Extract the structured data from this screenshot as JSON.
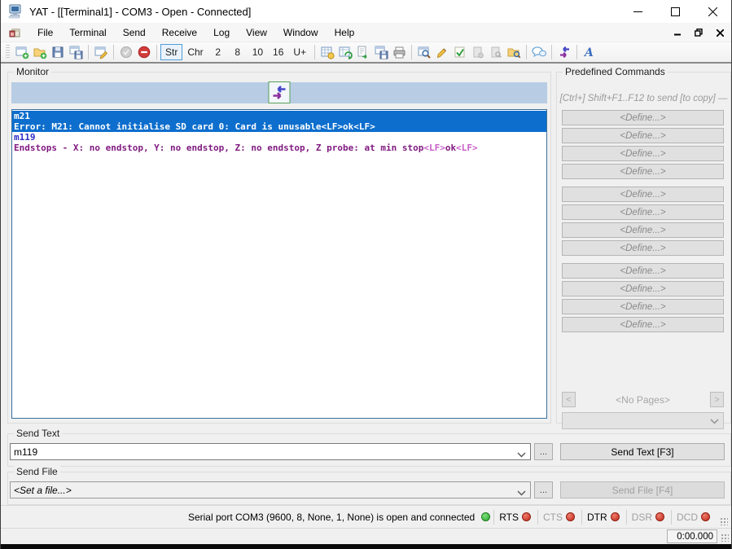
{
  "window": {
    "title": "YAT - [[Terminal1] - COM3 - Open - Connected]"
  },
  "menu": {
    "items": [
      "File",
      "Terminal",
      "Send",
      "Receive",
      "Log",
      "View",
      "Window",
      "Help"
    ]
  },
  "toolbar": {
    "radix": {
      "items": [
        "Str",
        "Chr",
        "2",
        "8",
        "10",
        "16",
        "U+"
      ],
      "selected": "Str"
    },
    "icons": [
      "new-terminal-icon",
      "open-terminal-icon",
      "save-terminal-icon",
      "save-workspace-icon",
      "terminal-settings-icon",
      "start-terminal-icon",
      "stop-terminal-icon",
      "format-settings-icon",
      "refresh-icon",
      "send-predefined-icon",
      "save-monitor-icon",
      "print-monitor-icon",
      "find-icon",
      "edit-pencil-icon",
      "edit-check-icon",
      "copy-page-icon",
      "preview-page-icon",
      "log-folder-icon",
      "auto-response-icon",
      "send-arrows-icon",
      "font-format-icon"
    ]
  },
  "monitor": {
    "label": "Monitor",
    "lines": [
      {
        "selected": true,
        "segments": [
          {
            "cls": "tx",
            "text": "m21"
          }
        ]
      },
      {
        "selected": true,
        "segments": [
          {
            "cls": "rx",
            "text": "Error: M21: Cannot initialise SD card 0: Card is unusable"
          },
          {
            "cls": "ctrl",
            "text": "<LF>"
          },
          {
            "cls": "rx",
            "text": "ok"
          },
          {
            "cls": "ctrl",
            "text": "<LF>"
          }
        ]
      },
      {
        "selected": false,
        "segments": [
          {
            "cls": "tx",
            "text": "m119"
          }
        ]
      },
      {
        "selected": false,
        "segments": [
          {
            "cls": "rx",
            "text": "Endstops - X: no endstop, Y: no endstop, Z: no endstop, Z probe: at min stop"
          },
          {
            "cls": "ctrl",
            "text": "<LF>"
          },
          {
            "cls": "rx",
            "text": "ok"
          },
          {
            "cls": "ctrl",
            "text": "<LF>"
          }
        ]
      }
    ]
  },
  "predefined": {
    "title": "Predefined Commands",
    "hint": "[Ctrl+] Shift+F1..F12 to send [to copy] —",
    "define_label": "<Define...>",
    "groups": [
      4,
      4,
      4
    ],
    "prev_label": "<",
    "next_label": ">",
    "no_pages": "<No Pages>"
  },
  "send_text": {
    "label": "Send Text",
    "value": "m119",
    "more_label": "...",
    "button": "Send Text [F3]"
  },
  "send_file": {
    "label": "Send File",
    "value": "<Set a file...>",
    "more_label": "...",
    "button": "Send File [F4]"
  },
  "status": {
    "message": "Serial port COM3 (9600, 8, None, 1, None) is open and connected",
    "signals": [
      {
        "label": "RTS",
        "active": true
      },
      {
        "label": "CTS",
        "active": false
      },
      {
        "label": "DTR",
        "active": true
      },
      {
        "label": "DSR",
        "active": false
      },
      {
        "label": "DCD",
        "active": false
      }
    ]
  },
  "timer": {
    "value": "0:00.000"
  },
  "colors": {
    "selection": "#0d6ecd",
    "tx": "#2d2dc8",
    "rx": "#801a80",
    "control": "#c75fc7",
    "monitor_bar": "#b8cce4",
    "status_red": "#c02818",
    "status_green": "#2aa52a"
  }
}
